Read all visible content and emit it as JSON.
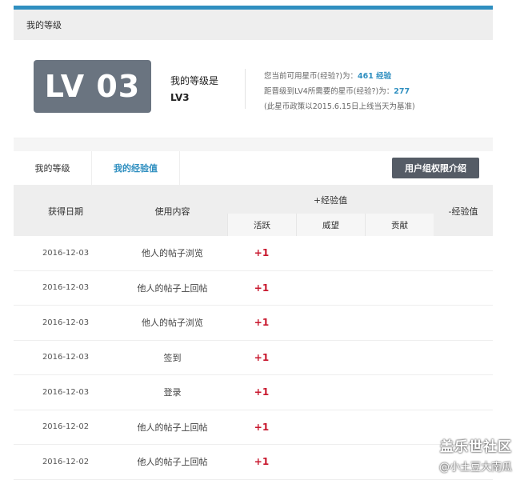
{
  "section": {
    "title": "我的等级"
  },
  "level": {
    "badge": "LV 03",
    "label": "我的等级是",
    "value": "LV3",
    "coins_prefix": "您当前可用星币(经验?)为：",
    "coins_value": "461 经验",
    "next_prefix": "距晋级到LV4所需要的星币(经验?)为：",
    "next_value": "277",
    "note": "(此星币政策以2015.6.15日上线当天为基准)"
  },
  "tabs": [
    {
      "label": "我的等级",
      "active": false
    },
    {
      "label": "我的经验值",
      "active": true
    }
  ],
  "permission_button": "用户组权限介绍",
  "table": {
    "headers": {
      "date": "获得日期",
      "content": "使用内容",
      "plus": "+经验值",
      "active": "活跃",
      "prestige": "威望",
      "contribution": "贡献",
      "minus": "-经验值"
    },
    "rows": [
      {
        "date": "2016-12-03",
        "content": "他人的帖子浏览",
        "active": "+1"
      },
      {
        "date": "2016-12-03",
        "content": "他人的帖子上回帖",
        "active": "+1"
      },
      {
        "date": "2016-12-03",
        "content": "他人的帖子浏览",
        "active": "+1"
      },
      {
        "date": "2016-12-03",
        "content": "签到",
        "active": "+1"
      },
      {
        "date": "2016-12-03",
        "content": "登录",
        "active": "+1"
      },
      {
        "date": "2016-12-02",
        "content": "他人的帖子上回帖",
        "active": "+1"
      },
      {
        "date": "2016-12-02",
        "content": "他人的帖子上回帖",
        "active": "+1"
      }
    ]
  },
  "watermark": {
    "title": "盖乐世社区",
    "user": "@小土豆大南瓜"
  },
  "colors": {
    "accent": "#2f8fc0",
    "badge_bg": "#6a7480",
    "gain": "#c8162c",
    "button_bg": "#555c66"
  }
}
